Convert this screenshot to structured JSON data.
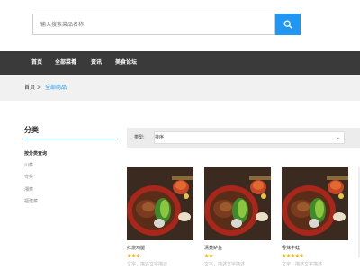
{
  "search": {
    "placeholder": "输入搜索菜品名称"
  },
  "nav": {
    "items": [
      "首页",
      "全部菜肴",
      "资讯",
      "美食论坛"
    ]
  },
  "breadcrumb": {
    "home": "首页",
    "separator": ">",
    "current": "全部商品"
  },
  "sidebar": {
    "title": "分类",
    "items": [
      "按分类查询",
      "川菜",
      "粤菜",
      "湘菜",
      "福建菜"
    ],
    "active_index": 0
  },
  "filter": {
    "label": "类型:",
    "selected": "排序"
  },
  "products": [
    {
      "name": "红烧鸡腿",
      "rating": 3,
      "desc": "文字，描述文字描述"
    },
    {
      "name": "清蒸鲈鱼",
      "rating": 2,
      "desc": "文字，描述文字描述"
    },
    {
      "name": "香辣牛蛙",
      "rating": 5,
      "desc": "文字，描述文字描述"
    }
  ],
  "colors": {
    "accent": "#2196f3",
    "nav_bg": "#3a3a3a",
    "star": "#f6b400"
  },
  "icons": {
    "search_button": "search-icon",
    "select_caret": "chevron-down-icon"
  }
}
